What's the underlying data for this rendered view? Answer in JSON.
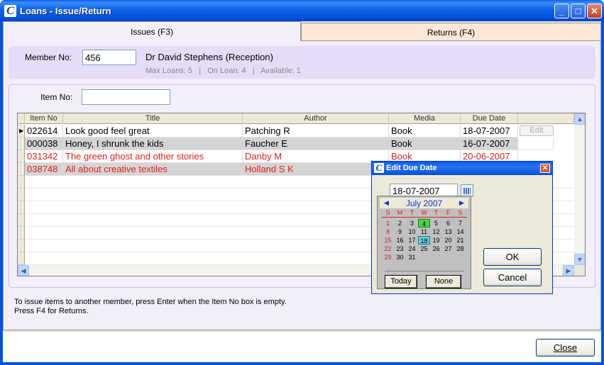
{
  "window": {
    "title": "Loans - Issue/Return",
    "app_icon": "C"
  },
  "tabs": [
    {
      "label": "Issues (F3)",
      "active": true
    },
    {
      "label": "Returns (F4)",
      "active": false
    }
  ],
  "member": {
    "label": "Member No:",
    "value": "456",
    "name": "Dr David Stephens (Reception)",
    "stats": "Max Loans: 5   |   On Loan: 4   |   Available: 1"
  },
  "item": {
    "label": "Item No:",
    "value": ""
  },
  "grid": {
    "columns": [
      "Item No",
      "Title",
      "Author",
      "Media",
      "Due Date"
    ],
    "rows": [
      {
        "item_no": "022614",
        "title": "Look good feel great",
        "author": "Patching R",
        "media": "Book",
        "due": "18-07-2007",
        "overdue": false,
        "action": "Edit"
      },
      {
        "item_no": "000038",
        "title": "Honey, I shrunk the kids",
        "author": "Faucher E",
        "media": "Book",
        "due": "16-07-2007",
        "overdue": false
      },
      {
        "item_no": "031342",
        "title": "The green ghost and other stories",
        "author": "Danby M",
        "media": "Book",
        "due": "20-06-2007",
        "overdue": true
      },
      {
        "item_no": "038748",
        "title": "All about creative textiles",
        "author": "Holland S K",
        "media": "",
        "due": "",
        "overdue": true
      }
    ]
  },
  "hints": {
    "line1": "To issue items to another member, press Enter when the Item No box is empty.",
    "line2": "Press F4 for Returns."
  },
  "buttons": {
    "close": "Close"
  },
  "edit_due_dialog": {
    "title": "Edit Due Date",
    "date_value": "18-07-2007",
    "calendar": {
      "month": "July 2007",
      "days_of_week": [
        "S",
        "M",
        "T",
        "W",
        "T",
        "F",
        "S"
      ],
      "weeks": [
        [
          "1",
          "2",
          "3",
          "4",
          "5",
          "6",
          "7"
        ],
        [
          "8",
          "9",
          "10",
          "11",
          "12",
          "13",
          "14"
        ],
        [
          "15",
          "16",
          "17",
          "18",
          "19",
          "20",
          "21"
        ],
        [
          "22",
          "23",
          "24",
          "25",
          "26",
          "27",
          "28"
        ],
        [
          "29",
          "30",
          "31",
          "",
          "",
          "",
          ""
        ]
      ],
      "today": "4",
      "selected": "18",
      "today_button": "Today",
      "none_button": "None"
    },
    "ok": "OK",
    "cancel": "Cancel"
  },
  "colors": {
    "title_blue": "#0054e3",
    "overdue_red": "#e0201a",
    "panel_lavender": "#f2eefa",
    "returns_tab": "#fde8d8"
  }
}
